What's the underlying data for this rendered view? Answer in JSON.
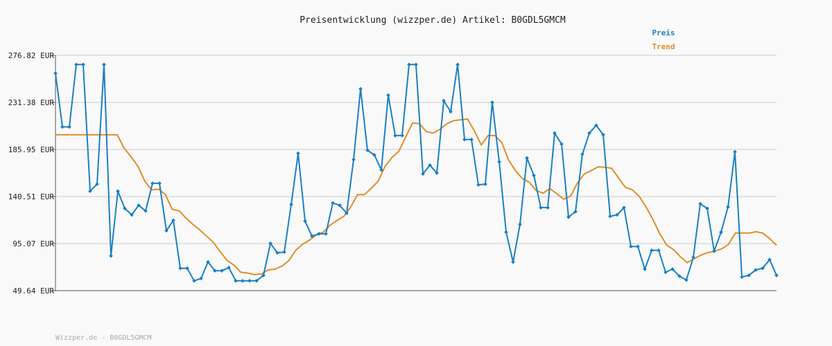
{
  "chart_data": {
    "type": "line",
    "title": "Preisentwicklung (wizzper.de) Artikel: B0GDL5GMCM",
    "footer": "Wizzper.de - B0GDL5GMCM",
    "y_ticks": [
      "276.82 EUR",
      "231.38 EUR",
      "185.95 EUR",
      "140.51 EUR",
      "95.07 EUR",
      "49.64 EUR"
    ],
    "y_tick_values": [
      276.82,
      231.38,
      185.95,
      140.51,
      95.07,
      49.64
    ],
    "ylim": [
      49.64,
      276.82
    ],
    "grid": true,
    "legend_position": "top-right",
    "series": [
      {
        "name": "Preis",
        "color": "#1a7fc4",
        "markers": true,
        "values": [
          259.5,
          207.7,
          207.7,
          267.9,
          267.9,
          145.7,
          152.5,
          267.9,
          83.2,
          145.7,
          129.0,
          122.9,
          132.0,
          126.7,
          153.3,
          153.3,
          107.6,
          117.5,
          71.2,
          71.2,
          59.1,
          61.4,
          77.3,
          68.9,
          68.9,
          71.9,
          59.1,
          59.1,
          59.1,
          59.1,
          64.4,
          95.3,
          86.2,
          86.9,
          132.8,
          182.2,
          116.7,
          102.3,
          104.5,
          104.5,
          134.3,
          132.0,
          124.4,
          176.2,
          244.5,
          185.2,
          180.6,
          166.2,
          238.4,
          199.4,
          199.4,
          267.9,
          267.9,
          162.4,
          170.8,
          163.2,
          233.0,
          222.4,
          267.9,
          195.6,
          195.6,
          151.8,
          152.5,
          231.4,
          174.0,
          106.1,
          77.3,
          113.7,
          177.7,
          160.9,
          129.8,
          129.8,
          201.7,
          191.1,
          120.6,
          125.9,
          181.4,
          201.7,
          209.3,
          200.2,
          121.4,
          122.9,
          129.8,
          92.3,
          92.3,
          70.4,
          88.5,
          88.5,
          67.4,
          70.4,
          63.6,
          59.9,
          81.9,
          133.5,
          129.0,
          87.8,
          106.1,
          130.5,
          183.7,
          62.8,
          64.4,
          69.6,
          71.2,
          79.6,
          64.4
        ]
      },
      {
        "name": "Trend",
        "color": "#e08c28",
        "markers": false,
        "values": [
          200.2,
          200.2,
          200.2,
          200.2,
          200.2,
          200.2,
          200.2,
          200.2,
          200.2,
          200.2,
          187.3,
          178.9,
          169.8,
          155.4,
          147.0,
          147.7,
          142.4,
          128.2,
          126.7,
          119.8,
          113.7,
          108.4,
          102.3,
          96.2,
          87.1,
          78.8,
          74.2,
          67.4,
          66.6,
          65.1,
          65.9,
          69.6,
          70.4,
          73.4,
          78.8,
          88.7,
          94.5,
          98.4,
          103.7,
          106.1,
          112.9,
          117.5,
          121.4,
          130.5,
          142.4,
          142.4,
          148.5,
          155.4,
          169.8,
          178.2,
          184.2,
          197.9,
          211.6,
          210.8,
          203.2,
          201.7,
          205.5,
          210.8,
          213.9,
          214.6,
          215.4,
          203.9,
          190.3,
          199.4,
          199.4,
          192.6,
          175.5,
          165.4,
          157.8,
          154.3,
          146.3,
          143.7,
          148.1,
          143.3,
          137.9,
          141.0,
          153.6,
          162.3,
          165.5,
          169.2,
          168.8,
          167.8,
          158.3,
          149.3,
          147.0,
          140.8,
          130.5,
          118.3,
          104.5,
          93.8,
          89.2,
          82.3,
          76.7,
          80.4,
          84.0,
          86.3,
          87.8,
          89.9,
          94.3,
          105.2,
          105.2,
          105.2,
          106.5,
          105.2,
          99.9,
          93.5
        ]
      }
    ]
  }
}
